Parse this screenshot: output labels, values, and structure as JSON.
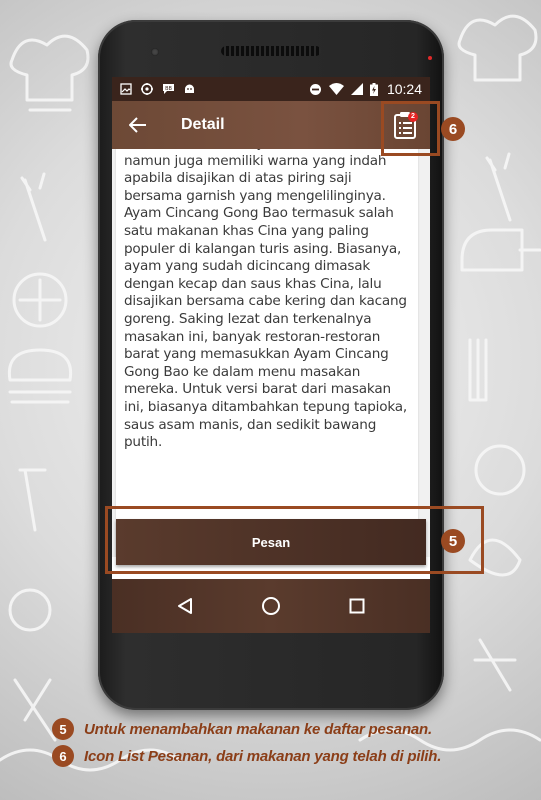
{
  "status_bar": {
    "time": "10:24"
  },
  "app_bar": {
    "title": "Detail",
    "order_badge_count": "2"
  },
  "description": "Masakan ini tak hanya lezat di lidah, namun juga memiliki warna yang indah apabila disajikan di atas piring saji bersama garnish yang mengelilinginya. Ayam Cincang Gong Bao termasuk salah satu makanan khas Cina yang paling populer di kalangan turis asing. Biasanya, ayam yang sudah dicincang dimasak dengan kecap dan saus khas Cina, lalu disajikan bersama cabe kering dan kacang goreng. Saking lezat dan terkenalnya masakan ini, banyak restoran-restoran barat yang memasukkan Ayam Cincang Gong Bao ke dalam menu masakan mereka. Untuk versi barat dari masakan ini, biasanya ditambahkan tepung tapioka, saus asam manis, dan sedikit bawang putih.",
  "order_button": {
    "label": "Pesan"
  },
  "annotations": {
    "marker_5": "5",
    "marker_6": "6"
  },
  "legend": [
    {
      "number": "5",
      "text": "Untuk menambahkan makanan ke daftar pesanan."
    },
    {
      "number": "6",
      "text": "Icon List Pesanan, dari makanan yang telah di pilih."
    }
  ],
  "colors": {
    "app_bar": "#7a5240",
    "status_bar": "#3a241c",
    "button": "#4d3227",
    "annotation": "#9a4a22",
    "legend_text": "#8b3e18"
  }
}
